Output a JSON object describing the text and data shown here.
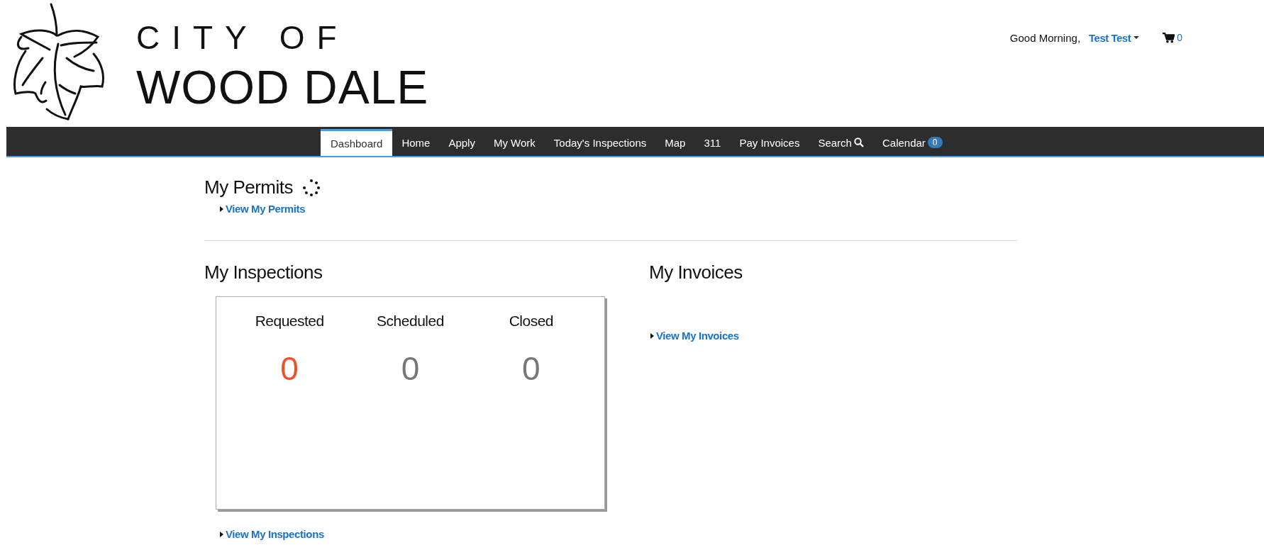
{
  "header": {
    "logo_line_1": "CITY OF",
    "logo_line_2": "WOOD DALE",
    "greeting": "Good Morning,",
    "user_name": "Test Test",
    "cart_count": "0"
  },
  "nav": [
    {
      "label": "Dashboard",
      "selected": true,
      "kind": "plain"
    },
    {
      "label": "Home",
      "selected": false,
      "kind": "plain"
    },
    {
      "label": "Apply",
      "selected": false,
      "kind": "plain"
    },
    {
      "label": "My Work",
      "selected": false,
      "kind": "plain"
    },
    {
      "label": "Today's Inspections",
      "selected": false,
      "kind": "plain"
    },
    {
      "label": "Map",
      "selected": false,
      "kind": "plain"
    },
    {
      "label": "311",
      "selected": false,
      "kind": "plain"
    },
    {
      "label": "Pay Invoices",
      "selected": false,
      "kind": "plain"
    },
    {
      "label": "Search",
      "selected": false,
      "kind": "search"
    },
    {
      "label": "Calendar",
      "selected": false,
      "kind": "badge",
      "badge": "0"
    }
  ],
  "permits": {
    "title": "My Permits",
    "link": "View My Permits"
  },
  "inspections": {
    "title": "My Inspections",
    "link": "View My Inspections",
    "stats": [
      {
        "label": "Requested",
        "value": "0",
        "color": "#e8532e"
      },
      {
        "label": "Scheduled",
        "value": "0",
        "color": "#777777"
      },
      {
        "label": "Closed",
        "value": "0",
        "color": "#777777"
      }
    ]
  },
  "invoices": {
    "title": "My Invoices",
    "link": "View My Invoices"
  }
}
